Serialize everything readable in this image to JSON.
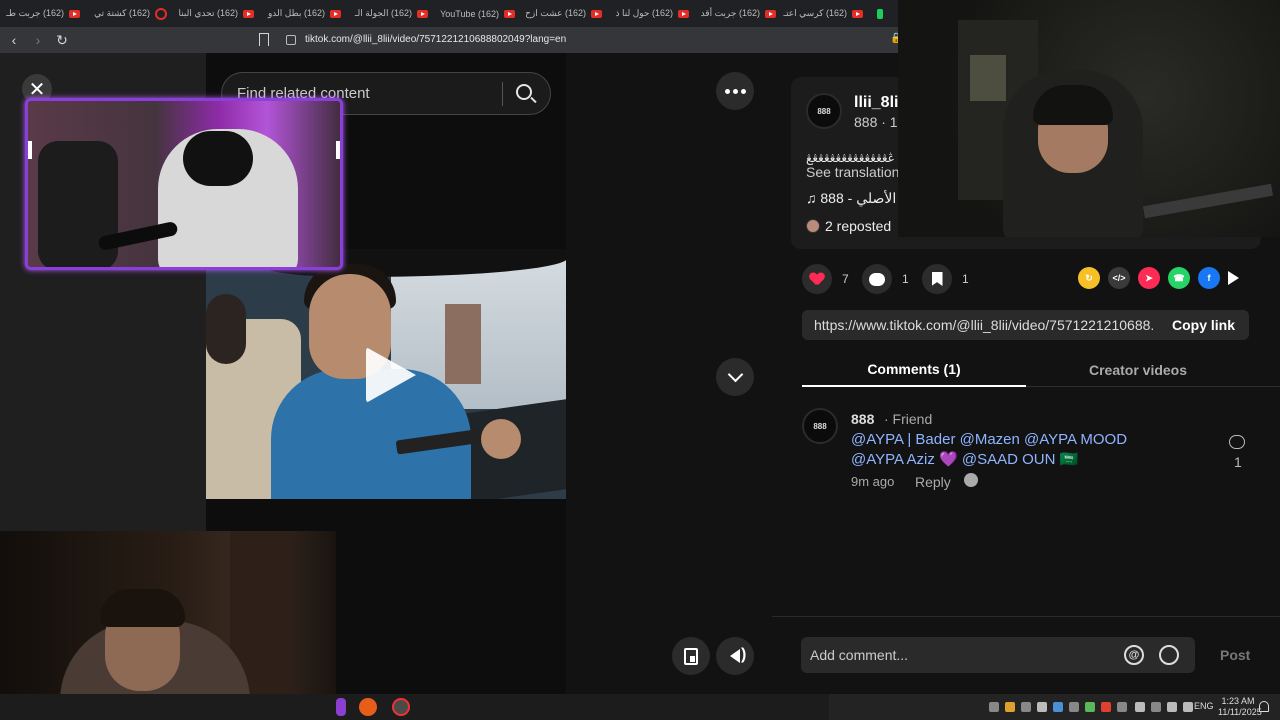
{
  "browser": {
    "tabs": [
      {
        "label": "(162) جربت طـ",
        "icon": "youtube-icon"
      },
      {
        "label": "(162) كشتة تي",
        "icon": "loading-icon"
      },
      {
        "label": "(162) تحدي البنا",
        "icon": "youtube-icon"
      },
      {
        "label": "(162) بطل الدو",
        "icon": "youtube-icon"
      },
      {
        "label": "(162) الجولة الـ",
        "icon": "youtube-icon"
      },
      {
        "label": "(162) YouTube",
        "icon": "youtube-icon"
      },
      {
        "label": "(162) عشت ازح",
        "icon": "youtube-icon"
      },
      {
        "label": "(162) حول لنا ذ",
        "icon": "youtube-icon"
      },
      {
        "label": "(162) جربت أقد",
        "icon": "youtube-icon"
      },
      {
        "label": "(162) كرسي اعتـ",
        "icon": "youtube-icon"
      }
    ],
    "url": "tiktok.com/@llii_8lii/video/7571221210688802049?lang=en"
  },
  "search": {
    "placeholder": "Find related content"
  },
  "post": {
    "username": "llii_8li",
    "sub_line": "888 · 1",
    "caption": "ڠڠڠڠڠڠڠڠڠڠڠڠڠڠڠ",
    "see_translation": "See translation",
    "music": "888 - الأصلي",
    "reposted": "2 reposted",
    "avatar_text": "888"
  },
  "actions": {
    "likes": "7",
    "comments": "1",
    "saves": "1"
  },
  "share": {
    "icons": [
      "repost-icon",
      "embed-icon",
      "send-icon",
      "whatsapp-icon",
      "facebook-icon",
      "share-arrow-icon"
    ],
    "colors": {
      "repost": "#f6c026",
      "embed": "#3a3a3a",
      "send": "#fe2c55",
      "whatsapp": "#25d366",
      "facebook": "#1877f2"
    }
  },
  "link": {
    "url": "https://www.tiktok.com/@llii_8lii/video/7571221210688...",
    "copy_label": "Copy link"
  },
  "tabs": {
    "comments": "Comments (1)",
    "creator_videos": "Creator videos"
  },
  "comment": {
    "author": "888",
    "tag": "· Friend",
    "text": "@AYPA | Bader @Mazen @AYPA MOOD @AYPA Aziz 💜 @SAAD OUN 🇸🇦",
    "time": "9m ago",
    "reply": "Reply",
    "likes": "1",
    "avatar_text": "888"
  },
  "composer": {
    "placeholder": "Add comment...",
    "post_label": "Post"
  },
  "taskbar": {
    "lang": "ENG",
    "time": "1:23 AM",
    "date": "11/11/2025"
  },
  "colors": {
    "accent_red": "#fe2c55",
    "link_blue": "#8fb4ff",
    "overlay_purple": "#8b3fd9"
  }
}
